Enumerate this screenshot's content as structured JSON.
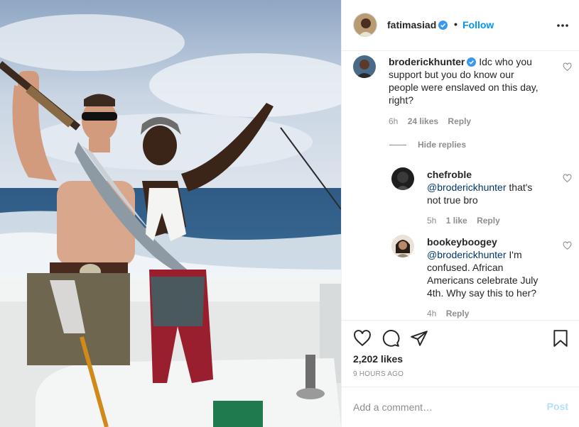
{
  "header": {
    "username": "fatimasiad",
    "separator": "•",
    "follow_label": "Follow"
  },
  "comments": [
    {
      "username": "broderickhunter",
      "verified": true,
      "text": "Idc who you support but you do know our people were enslaved on this day, right?",
      "line1": "Idc who you",
      "line2": "support but you do know our",
      "line3": "people were enslaved on this day,",
      "line4": "right?",
      "time": "6h",
      "likes": "24 likes",
      "reply_label": "Reply"
    }
  ],
  "hide_replies_label": "Hide replies",
  "replies": [
    {
      "username": "chefroble",
      "mention": "@broderickhunter",
      "text_after_mention": " that's",
      "line2": "not true bro",
      "time": "5h",
      "likes": "1 like",
      "reply_label": "Reply"
    },
    {
      "username": "bookeyboogey",
      "mention": "@broderickhunter",
      "text_after_mention": " I'm",
      "line2": "confused. African",
      "line3": "Americans celebrate July",
      "line4": "4th. Why say this to her?",
      "time": "4h",
      "reply_label": "Reply"
    }
  ],
  "actions": {
    "likes": "2,202 likes",
    "time_ago": "9 HOURS AGO"
  },
  "add_comment": {
    "placeholder": "Add a comment…",
    "post_label": "Post"
  },
  "colors": {
    "link_blue": "#0095f6",
    "muted": "#8e8e8e",
    "verified_blue": "#3897f0"
  },
  "icons": [
    "heart-icon",
    "comment-icon",
    "share-icon",
    "bookmark-icon",
    "more-icon",
    "verified-icon"
  ]
}
